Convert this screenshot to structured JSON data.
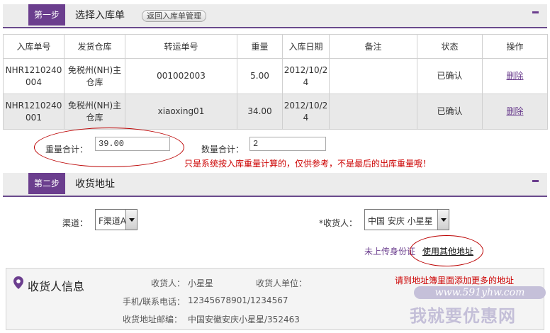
{
  "step1": {
    "badge": "第一步",
    "title": "选择入库单",
    "back_label": "返回入库单管理"
  },
  "table": {
    "headers": [
      "入库单号",
      "发货仓库",
      "转运单号",
      "重量",
      "入库日期",
      "备注",
      "状态",
      "操作"
    ],
    "rows": [
      {
        "no_line1": "NHR1210240",
        "no_line2": "004",
        "wh_line1": "免税州(NH)主",
        "wh_line2": "仓库",
        "tracking": "001002003",
        "weight": "5.00",
        "date_line1": "2012/10/2",
        "date_line2": "4",
        "remark": "",
        "status": "已确认",
        "action": "删除"
      },
      {
        "no_line1": "NHR1210240",
        "no_line2": "001",
        "wh_line1": "免税州(NH)主",
        "wh_line2": "仓库",
        "tracking": "xiaoxing01",
        "weight": "34.00",
        "date_line1": "2012/10/2",
        "date_line2": "4",
        "remark": "",
        "status": "已确认",
        "action": "删除"
      }
    ]
  },
  "summary": {
    "weight_label": "重量合计：",
    "weight_value": "39.00",
    "count_label": "数量合计：",
    "count_value": "2",
    "warning": "只是系统按入库重量计算的，仅供参考，不是最后的出库重量哦！"
  },
  "step2": {
    "badge": "第二步",
    "title": "收货地址"
  },
  "shipping": {
    "channel_label": "渠道：",
    "channel_value": "F渠道A",
    "receiver_label": "*收货人：",
    "receiver_value": "中国 安庆 小星星",
    "id_link": "未上传身份证",
    "other_addr_link": "使用其他地址"
  },
  "receiver_info": {
    "title": "收货人信息",
    "name_label": "收货人：",
    "name_value": "小星星",
    "unit_label": "收货人单位：",
    "unit_value": "",
    "phone_label": "手机/联系电话：",
    "phone_value": "12345678901/1234567",
    "addr_label": "收货地址邮编：",
    "addr_value": "中国安徽安庆小星星/352463",
    "note": "请到地址簿里面添加更多的地址"
  },
  "watermark": {
    "url": "www.591yhw.com",
    "text": "我就要优惠网"
  },
  "colors": {
    "brand_purple": "#6b3e8e",
    "warning_red": "#cc0000",
    "row_alt": "#e9e9e9"
  }
}
